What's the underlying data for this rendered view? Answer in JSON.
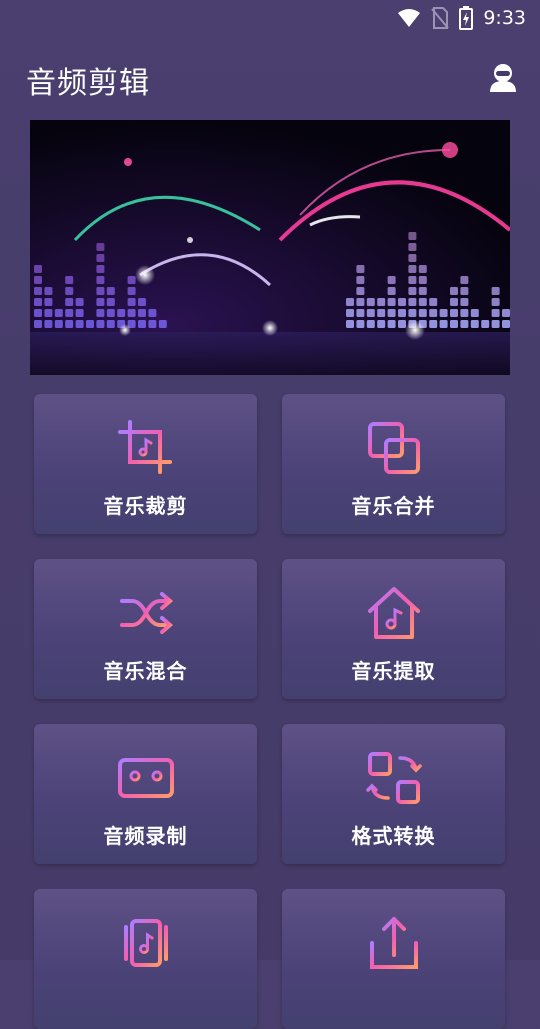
{
  "status_bar": {
    "time": "9:33",
    "icons": [
      "wifi-icon",
      "no-sim-icon",
      "battery-charging-icon"
    ]
  },
  "header": {
    "title": "音频剪辑",
    "user_icon": "user-avatar-icon"
  },
  "banner": {
    "description_icon": "audio-equalizer-banner"
  },
  "features": [
    {
      "label": "音乐裁剪",
      "icon": "crop-music-icon"
    },
    {
      "label": "音乐合并",
      "icon": "merge-squares-icon"
    },
    {
      "label": "音乐混合",
      "icon": "shuffle-icon"
    },
    {
      "label": "音乐提取",
      "icon": "house-music-icon"
    },
    {
      "label": "音频录制",
      "icon": "cassette-icon"
    },
    {
      "label": "格式转换",
      "icon": "convert-icon"
    },
    {
      "label": "",
      "icon": "music-card-stack-icon"
    },
    {
      "label": "",
      "icon": "upload-icon"
    }
  ],
  "colors": {
    "accent_pink": "#f25fb0",
    "accent_purple": "#b07cff",
    "accent_orange": "#ff9a6b"
  }
}
